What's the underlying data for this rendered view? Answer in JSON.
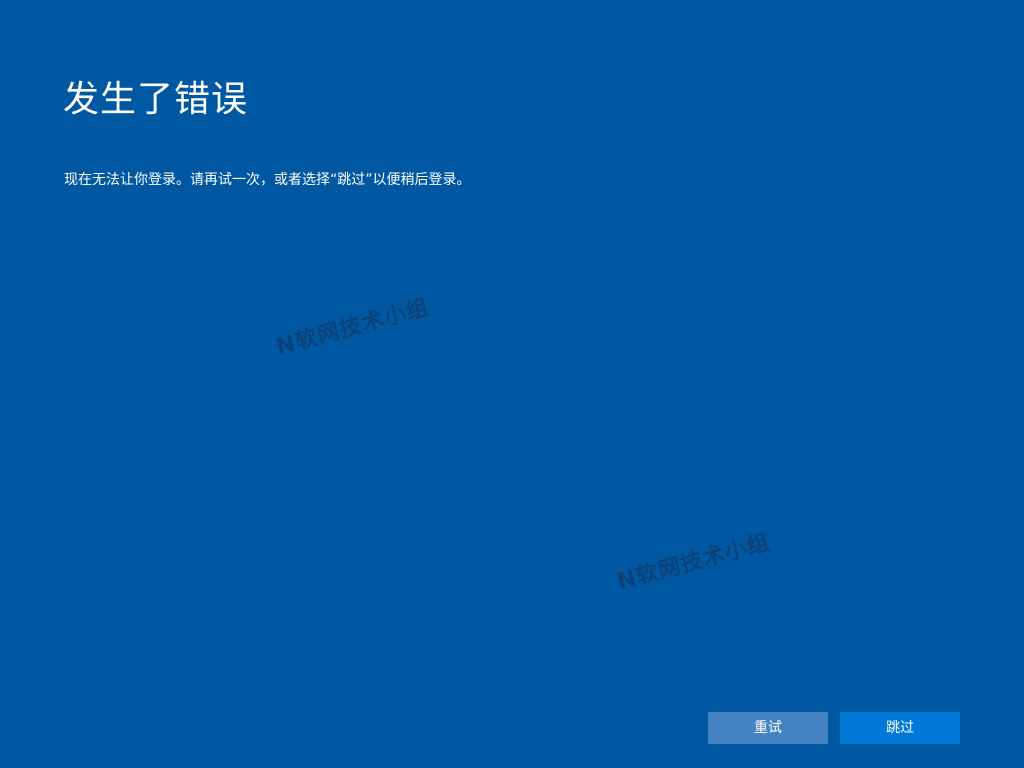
{
  "title": "发生了错误",
  "message": "现在无法让你登录。请再试一次，或者选择“跳过”以便稍后登录。",
  "watermark": "N软网技术小组",
  "buttons": {
    "retry": "重试",
    "skip": "跳过"
  },
  "colors": {
    "background": "#0058a3",
    "retry_button": "#4483c1",
    "skip_button": "#0078d7"
  }
}
